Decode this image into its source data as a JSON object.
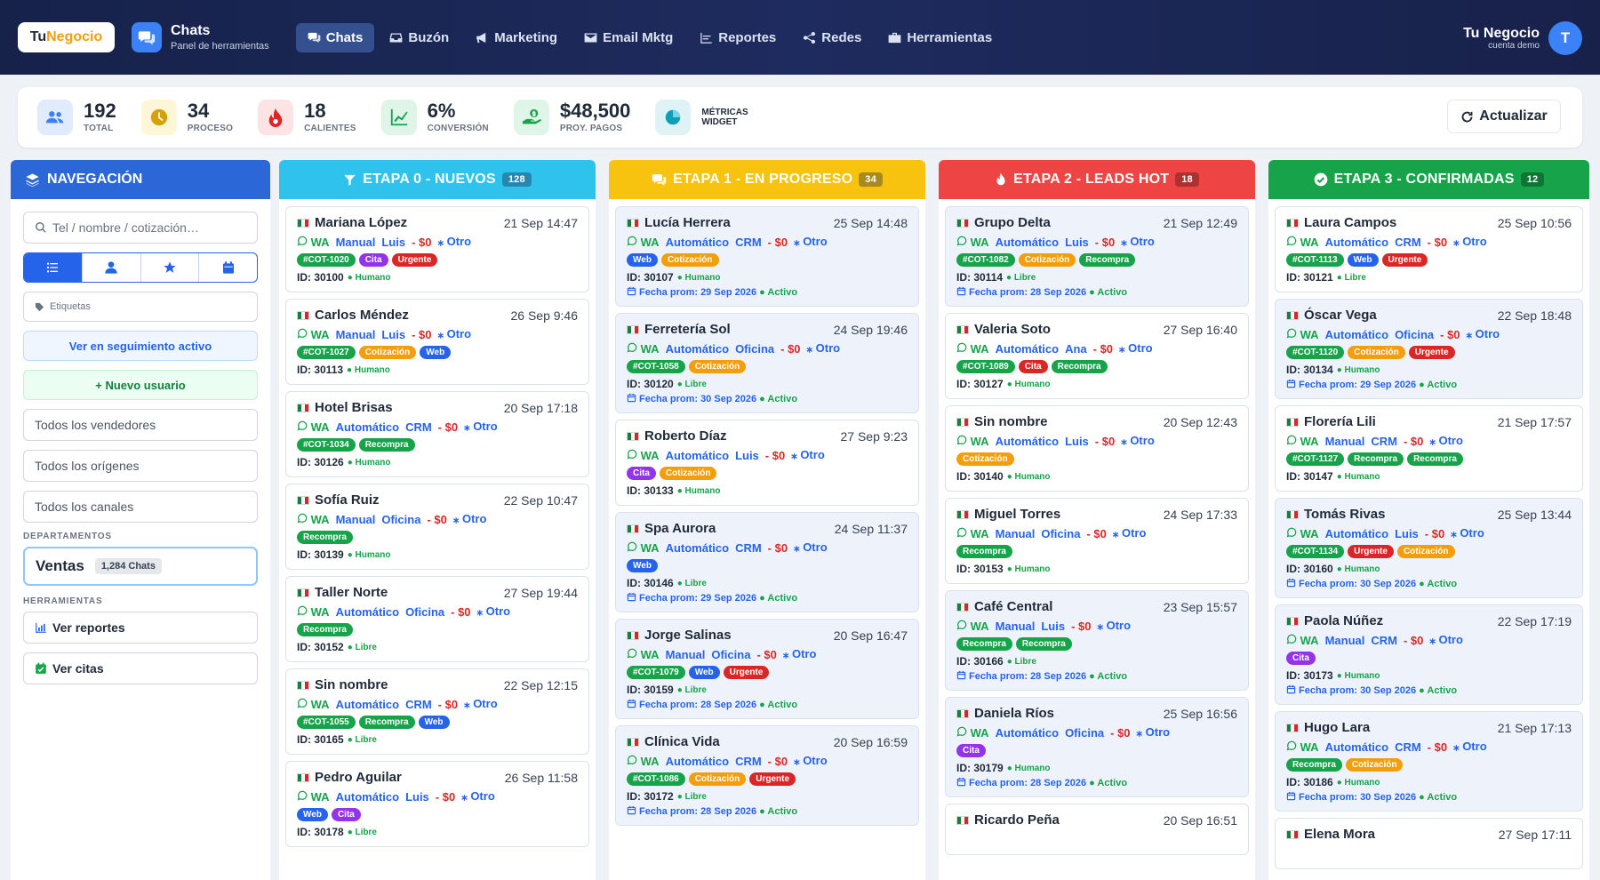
{
  "logo": {
    "part1": "Tu",
    "part2": "Negocio"
  },
  "app": {
    "title": "Chats",
    "subtitle": "Panel de herramientas"
  },
  "nav": [
    {
      "label": "Chats",
      "icon": "chat-icon",
      "active": true
    },
    {
      "label": "Buzón",
      "icon": "inbox-icon",
      "active": false
    },
    {
      "label": "Marketing",
      "icon": "megaphone-icon",
      "active": false
    },
    {
      "label": "Email Mktg",
      "icon": "envelope-icon",
      "active": false
    },
    {
      "label": "Reportes",
      "icon": "chart-icon",
      "active": false
    },
    {
      "label": "Redes",
      "icon": "share-icon",
      "active": false
    },
    {
      "label": "Herramientas",
      "icon": "toolbox-icon",
      "active": false
    }
  ],
  "user": {
    "name": "Tu Negocio",
    "sub": "cuenta demo",
    "initial": "T"
  },
  "stats": [
    {
      "value": "192",
      "label": "TOTAL",
      "icon": "users-icon",
      "bg": "#e0ecfb",
      "fg": "#3b82f6"
    },
    {
      "value": "34",
      "label": "PROCESO",
      "icon": "clock-icon",
      "bg": "#fef6d6",
      "fg": "#d4a106"
    },
    {
      "value": "18",
      "label": "CALIENTES",
      "icon": "flame-icon",
      "bg": "#fde4e4",
      "fg": "#dc2626"
    },
    {
      "value": "6%",
      "label": "CONVERSIÓN",
      "icon": "trend-icon",
      "bg": "#dff5e8",
      "fg": "#16a34a"
    },
    {
      "value": "$48,500",
      "label": "PROY. PAGOS",
      "icon": "money-icon",
      "bg": "#dff5e8",
      "fg": "#16a34a"
    }
  ],
  "widget": {
    "label1": "MÉTRICAS",
    "label2": "WIDGET"
  },
  "refresh": "Actualizar",
  "sidebar": {
    "title": "NAVEGACIÓN",
    "search_placeholder": "Tel / nombre / cotización…",
    "tags_placeholder": "Etiquetas",
    "follow_btn": "Ver en seguimiento activo",
    "new_user_btn": "+ Nuevo usuario",
    "sellers": "Todos los vendedores",
    "origins": "Todos los orígenes",
    "channels": "Todos los canales",
    "dept_section": "DEPARTAMENTOS",
    "dept_name": "Ventas",
    "dept_count": "1,284 Chats",
    "tools_section": "HERRAMIENTAS",
    "reports": "Ver reportes",
    "appointments": "Ver citas"
  },
  "columns": [
    {
      "title": "ETAPA 0 - NUEVOS",
      "count": "128",
      "color": "#2fc2ec",
      "cards": [
        {
          "name": "Mariana López",
          "date": "21 Sep 14:47",
          "mode": "Manual",
          "src": "Luis",
          "amt": "- $0",
          "other": "⁎ Otro",
          "tags": [
            [
              "#COT-1020",
              "green"
            ],
            [
              "Cita",
              "purple"
            ],
            [
              "Urgente",
              "red"
            ]
          ],
          "id": "ID: 30100",
          "status": "● Humano"
        },
        {
          "name": "Carlos Méndez",
          "date": "26 Sep 9:46",
          "mode": "Manual",
          "src": "Luis",
          "amt": "- $0",
          "other": "⁎ Otro",
          "tags": [
            [
              "#COT-1027",
              "green"
            ],
            [
              "Cotización",
              "orange"
            ],
            [
              "Web",
              "blue"
            ]
          ],
          "id": "ID: 30113",
          "status": "● Humano"
        },
        {
          "name": "Hotel Brisas",
          "date": "20 Sep 17:18",
          "mode": "Automático",
          "src": "CRM",
          "amt": "- $0",
          "other": "⁎ Otro",
          "tags": [
            [
              "#COT-1034",
              "green"
            ],
            [
              "Recompra",
              "green"
            ]
          ],
          "id": "ID: 30126",
          "status": "● Humano"
        },
        {
          "name": "Sofía Ruiz",
          "date": "22 Sep 10:47",
          "mode": "Manual",
          "src": "Oficina",
          "amt": "- $0",
          "other": "⁎ Otro",
          "tags": [
            [
              "Recompra",
              "green"
            ]
          ],
          "id": "ID: 30139",
          "status": "● Humano"
        },
        {
          "name": "Taller Norte",
          "date": "27 Sep 19:44",
          "mode": "Automático",
          "src": "Oficina",
          "amt": "- $0",
          "other": "⁎ Otro",
          "tags": [
            [
              "Recompra",
              "green"
            ]
          ],
          "id": "ID: 30152",
          "status": "● Libre"
        },
        {
          "name": "Sin nombre",
          "date": "22 Sep 12:15",
          "mode": "Automático",
          "src": "CRM",
          "amt": "- $0",
          "other": "⁎ Otro",
          "tags": [
            [
              "#COT-1055",
              "green"
            ],
            [
              "Recompra",
              "green"
            ],
            [
              "Web",
              "blue"
            ]
          ],
          "id": "ID: 30165",
          "status": "● Libre"
        },
        {
          "name": "Pedro Aguilar",
          "date": "26 Sep 11:58",
          "mode": "Automático",
          "src": "Luis",
          "amt": "- $0",
          "other": "⁎ Otro",
          "tags": [
            [
              "Web",
              "blue"
            ],
            [
              "Cita",
              "purple"
            ]
          ],
          "id": "ID: 30178",
          "status": "● Libre"
        }
      ]
    },
    {
      "title": "ETAPA 1 - EN PROGRESO",
      "count": "34",
      "color": "#f7c30e",
      "cards": [
        {
          "name": "Lucía Herrera",
          "date": "25 Sep 14:48",
          "mode": "Automático",
          "src": "CRM",
          "amt": "- $0",
          "other": "⁎ Otro",
          "tags": [
            [
              "Web",
              "blue"
            ],
            [
              "Cotización",
              "orange"
            ]
          ],
          "id": "ID: 30107",
          "status": "● Humano",
          "fp": "Fecha prom: 29 Sep 2026",
          "act": "● Activo"
        },
        {
          "name": "Ferretería Sol",
          "date": "24 Sep 19:46",
          "mode": "Automático",
          "src": "Oficina",
          "amt": "- $0",
          "other": "⁎ Otro",
          "tags": [
            [
              "#COT-1058",
              "green"
            ],
            [
              "Cotización",
              "orange"
            ]
          ],
          "id": "ID: 30120",
          "status": "● Libre",
          "fp": "Fecha prom: 30 Sep 2026",
          "act": "● Activo"
        },
        {
          "name": "Roberto Díaz",
          "date": "27 Sep 9:23",
          "mode": "Automático",
          "src": "Luis",
          "amt": "- $0",
          "other": "⁎ Otro",
          "tags": [
            [
              "Cita",
              "purple"
            ],
            [
              "Cotización",
              "orange"
            ]
          ],
          "id": "ID: 30133",
          "status": "● Humano"
        },
        {
          "name": "Spa Aurora",
          "date": "24 Sep 11:37",
          "mode": "Automático",
          "src": "CRM",
          "amt": "- $0",
          "other": "⁎ Otro",
          "tags": [
            [
              "Web",
              "blue"
            ]
          ],
          "id": "ID: 30146",
          "status": "● Libre",
          "fp": "Fecha prom: 29 Sep 2026",
          "act": "● Activo"
        },
        {
          "name": "Jorge Salinas",
          "date": "20 Sep 16:47",
          "mode": "Manual",
          "src": "Oficina",
          "amt": "- $0",
          "other": "⁎ Otro",
          "tags": [
            [
              "#COT-1079",
              "green"
            ],
            [
              "Web",
              "blue"
            ],
            [
              "Urgente",
              "red"
            ]
          ],
          "id": "ID: 30159",
          "status": "● Libre",
          "fp": "Fecha prom: 28 Sep 2026",
          "act": "● Activo"
        },
        {
          "name": "Clínica Vida",
          "date": "20 Sep 16:59",
          "mode": "Automático",
          "src": "CRM",
          "amt": "- $0",
          "other": "⁎ Otro",
          "tags": [
            [
              "#COT-1086",
              "green"
            ],
            [
              "Cotización",
              "orange"
            ],
            [
              "Urgente",
              "red"
            ]
          ],
          "id": "ID: 30172",
          "status": "● Libre",
          "fp": "Fecha prom: 28 Sep 2026",
          "act": "● Activo"
        }
      ]
    },
    {
      "title": "ETAPA 2 - LEADS HOT",
      "count": "18",
      "color": "#ef4444",
      "cards": [
        {
          "name": "Grupo Delta",
          "date": "21 Sep 12:49",
          "mode": "Automático",
          "src": "Luis",
          "amt": "- $0",
          "other": "⁎ Otro",
          "tags": [
            [
              "#COT-1082",
              "green"
            ],
            [
              "Cotización",
              "orange"
            ],
            [
              "Recompra",
              "green"
            ]
          ],
          "id": "ID: 30114",
          "status": "● Libre",
          "fp": "Fecha prom: 28 Sep 2026",
          "act": "● Activo"
        },
        {
          "name": "Valeria Soto",
          "date": "27 Sep 16:40",
          "mode": "Automático",
          "src": "Ana",
          "amt": "- $0",
          "other": "⁎ Otro",
          "tags": [
            [
              "#COT-1089",
              "green"
            ],
            [
              "Cita",
              "red"
            ],
            [
              "Recompra",
              "green"
            ]
          ],
          "id": "ID: 30127",
          "status": "● Humano"
        },
        {
          "name": "Sin nombre",
          "date": "20 Sep 12:43",
          "mode": "Automático",
          "src": "Luis",
          "amt": "- $0",
          "other": "⁎ Otro",
          "tags": [
            [
              "Cotización",
              "orange"
            ]
          ],
          "id": "ID: 30140",
          "status": "● Humano"
        },
        {
          "name": "Miguel Torres",
          "date": "24 Sep 17:33",
          "mode": "Manual",
          "src": "Oficina",
          "amt": "- $0",
          "other": "⁎ Otro",
          "tags": [
            [
              "Recompra",
              "green"
            ]
          ],
          "id": "ID: 30153",
          "status": "● Humano"
        },
        {
          "name": "Café Central",
          "date": "23 Sep 15:57",
          "mode": "Manual",
          "src": "Luis",
          "amt": "- $0",
          "other": "⁎ Otro",
          "tags": [
            [
              "Recompra",
              "green"
            ],
            [
              "Recompra",
              "green"
            ]
          ],
          "id": "ID: 30166",
          "status": "● Libre",
          "fp": "Fecha prom: 28 Sep 2026",
          "act": "● Activo"
        },
        {
          "name": "Daniela Ríos",
          "date": "25 Sep 16:56",
          "mode": "Automático",
          "src": "Oficina",
          "amt": "- $0",
          "other": "⁎ Otro",
          "tags": [
            [
              "Cita",
              "purple"
            ]
          ],
          "id": "ID: 30179",
          "status": "● Humano",
          "fp": "Fecha prom: 28 Sep 2026",
          "act": "● Activo"
        },
        {
          "name": "Ricardo Peña",
          "date": "20 Sep 16:51",
          "mode": "",
          "src": "",
          "amt": "",
          "other": "",
          "tags": [],
          "id": "",
          "status": ""
        }
      ]
    },
    {
      "title": "ETAPA 3 - CONFIRMADAS",
      "count": "12",
      "color": "#16a34a",
      "cards": [
        {
          "name": "Laura Campos",
          "date": "25 Sep 10:56",
          "mode": "Automático",
          "src": "CRM",
          "amt": "- $0",
          "other": "⁎ Otro",
          "tags": [
            [
              "#COT-1113",
              "green"
            ],
            [
              "Web",
              "blue"
            ],
            [
              "Urgente",
              "red"
            ]
          ],
          "id": "ID: 30121",
          "status": "● Libre"
        },
        {
          "name": "Óscar Vega",
          "date": "22 Sep 18:48",
          "mode": "Automático",
          "src": "Oficina",
          "amt": "- $0",
          "other": "⁎ Otro",
          "tags": [
            [
              "#COT-1120",
              "green"
            ],
            [
              "Cotización",
              "orange"
            ],
            [
              "Urgente",
              "red"
            ]
          ],
          "id": "ID: 30134",
          "status": "● Humano",
          "fp": "Fecha prom: 29 Sep 2026",
          "act": "● Activo"
        },
        {
          "name": "Florería Lili",
          "date": "21 Sep 17:57",
          "mode": "Manual",
          "src": "CRM",
          "amt": "- $0",
          "other": "⁎ Otro",
          "tags": [
            [
              "#COT-1127",
              "green"
            ],
            [
              "Recompra",
              "green"
            ],
            [
              "Recompra",
              "green"
            ]
          ],
          "id": "ID: 30147",
          "status": "● Humano"
        },
        {
          "name": "Tomás Rivas",
          "date": "25 Sep 13:44",
          "mode": "Automático",
          "src": "Luis",
          "amt": "- $0",
          "other": "⁎ Otro",
          "tags": [
            [
              "#COT-1134",
              "green"
            ],
            [
              "Urgente",
              "red"
            ],
            [
              "Cotización",
              "orange"
            ]
          ],
          "id": "ID: 30160",
          "status": "● Humano",
          "fp": "Fecha prom: 30 Sep 2026",
          "act": "● Activo"
        },
        {
          "name": "Paola Núñez",
          "date": "22 Sep 17:19",
          "mode": "Manual",
          "src": "CRM",
          "amt": "- $0",
          "other": "⁎ Otro",
          "tags": [
            [
              "Cita",
              "purple"
            ]
          ],
          "id": "ID: 30173",
          "status": "● Humano",
          "fp": "Fecha prom: 30 Sep 2026",
          "act": "● Activo"
        },
        {
          "name": "Hugo Lara",
          "date": "21 Sep 17:13",
          "mode": "Automático",
          "src": "CRM",
          "amt": "- $0",
          "other": "⁎ Otro",
          "tags": [
            [
              "Recompra",
              "green"
            ],
            [
              "Cotización",
              "orange"
            ]
          ],
          "id": "ID: 30186",
          "status": "● Humano",
          "fp": "Fecha prom: 30 Sep 2026",
          "act": "● Activo"
        },
        {
          "name": "Elena Mora",
          "date": "27 Sep 17:11",
          "mode": "",
          "src": "",
          "amt": "",
          "other": "",
          "tags": [],
          "id": "",
          "status": ""
        }
      ]
    }
  ]
}
